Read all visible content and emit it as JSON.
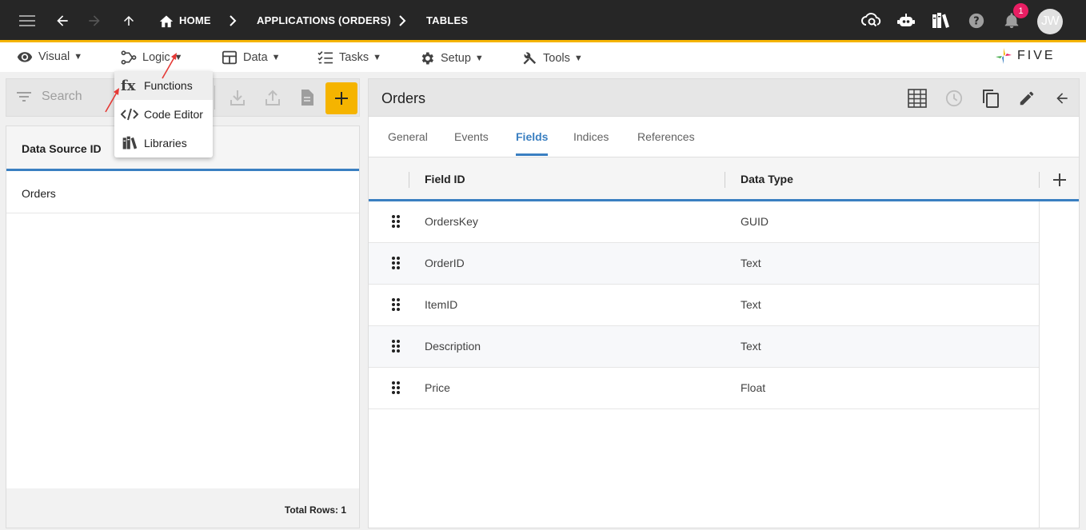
{
  "topbar": {
    "breadcrumb": [
      "HOME",
      "APPLICATIONS (ORDERS)",
      "TABLES"
    ],
    "notification_count": "1",
    "avatar_initials": "JW"
  },
  "menubar": {
    "items": [
      {
        "label": "Visual",
        "icon": "eye-icon"
      },
      {
        "label": "Logic",
        "icon": "logic-icon"
      },
      {
        "label": "Data",
        "icon": "table-icon"
      },
      {
        "label": "Tasks",
        "icon": "checklist-icon"
      },
      {
        "label": "Setup",
        "icon": "gear-icon"
      },
      {
        "label": "Tools",
        "icon": "tools-icon"
      }
    ],
    "brand": "FIVE"
  },
  "logic_dropdown": {
    "items": [
      "Functions",
      "Code Editor",
      "Libraries"
    ]
  },
  "left_panel": {
    "search_placeholder": "Search",
    "column_header": "Data Source ID",
    "rows": [
      "Orders"
    ],
    "footer": "Total Rows: 1"
  },
  "right_panel": {
    "title": "Orders",
    "tabs": [
      "General",
      "Events",
      "Fields",
      "Indices",
      "References"
    ],
    "active_tab": "Fields",
    "columns": [
      "Field ID",
      "Data Type"
    ],
    "rows": [
      {
        "field_id": "OrdersKey",
        "data_type": "GUID"
      },
      {
        "field_id": "OrderID",
        "data_type": "Text"
      },
      {
        "field_id": "ItemID",
        "data_type": "Text"
      },
      {
        "field_id": "Description",
        "data_type": "Text"
      },
      {
        "field_id": "Price",
        "data_type": "Float"
      }
    ]
  },
  "colors": {
    "topbar_bg": "#262626",
    "accent_yellow": "#f5b400",
    "accent_blue": "#3a7fc1",
    "badge": "#e91e63"
  }
}
